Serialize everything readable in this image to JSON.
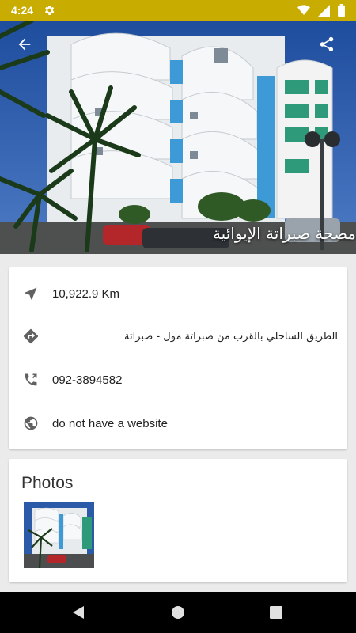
{
  "status_bar": {
    "time": "4:24",
    "icons": [
      "settings-gear-icon",
      "wifi-icon",
      "cellular-signal-icon",
      "battery-icon"
    ]
  },
  "header": {
    "place_name": "مصحة صبراتة الإيوائية",
    "back_icon": "arrow-back-icon",
    "share_icon": "share-icon"
  },
  "details": {
    "distance": "10,922.9 Km",
    "address": "الطريق الساحلي بالقرب من صبراتة مول - صبراتة",
    "phone": "092-3894582",
    "website": "do not have a website",
    "icons": [
      "navigation-arrow-icon",
      "directions-icon",
      "phone-icon",
      "globe-icon"
    ]
  },
  "photos": {
    "title": "Photos",
    "count": 1
  },
  "navigation": {
    "icons": [
      "back-triangle-icon",
      "home-circle-icon",
      "recents-square-icon"
    ]
  },
  "colors": {
    "status_bar": "#c9ac00",
    "background": "#ebebeb",
    "card": "#ffffff",
    "icon_gray": "#616161"
  }
}
